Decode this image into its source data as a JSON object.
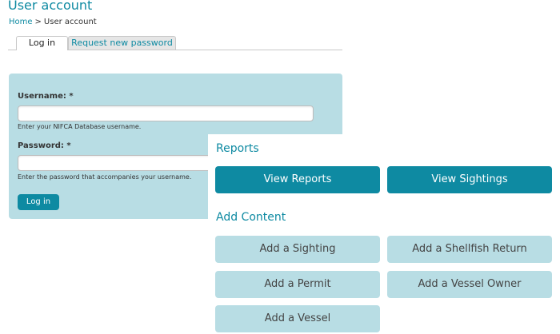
{
  "page": {
    "title": "User account",
    "breadcrumb": {
      "home": "Home",
      "separator": ">",
      "current": "User account"
    }
  },
  "tabs": [
    {
      "label": "Log in",
      "active": true
    },
    {
      "label": "Request new password",
      "active": false
    }
  ],
  "login_form": {
    "username_label": "Username:",
    "username_required": "*",
    "username_value": "",
    "username_help": "Enter your NIFCA Database username.",
    "password_label": "Password:",
    "password_required": "*",
    "password_value": "",
    "password_help": "Enter the password that accompanies your username.",
    "submit_label": "Log in"
  },
  "quick_links": {
    "reports_heading": "Reports",
    "reports": [
      "View Reports",
      "View Sightings"
    ],
    "content_heading": "Add Content",
    "content": [
      "Add a Sighting",
      "Add a Shellfish Return",
      "Add a Permit",
      "Add a Vessel Owner",
      "Add a Vessel"
    ]
  },
  "colors": {
    "accent": "#0e8aa2",
    "panel": "#b8dde4",
    "tab_inactive": "#e6e6e6"
  }
}
